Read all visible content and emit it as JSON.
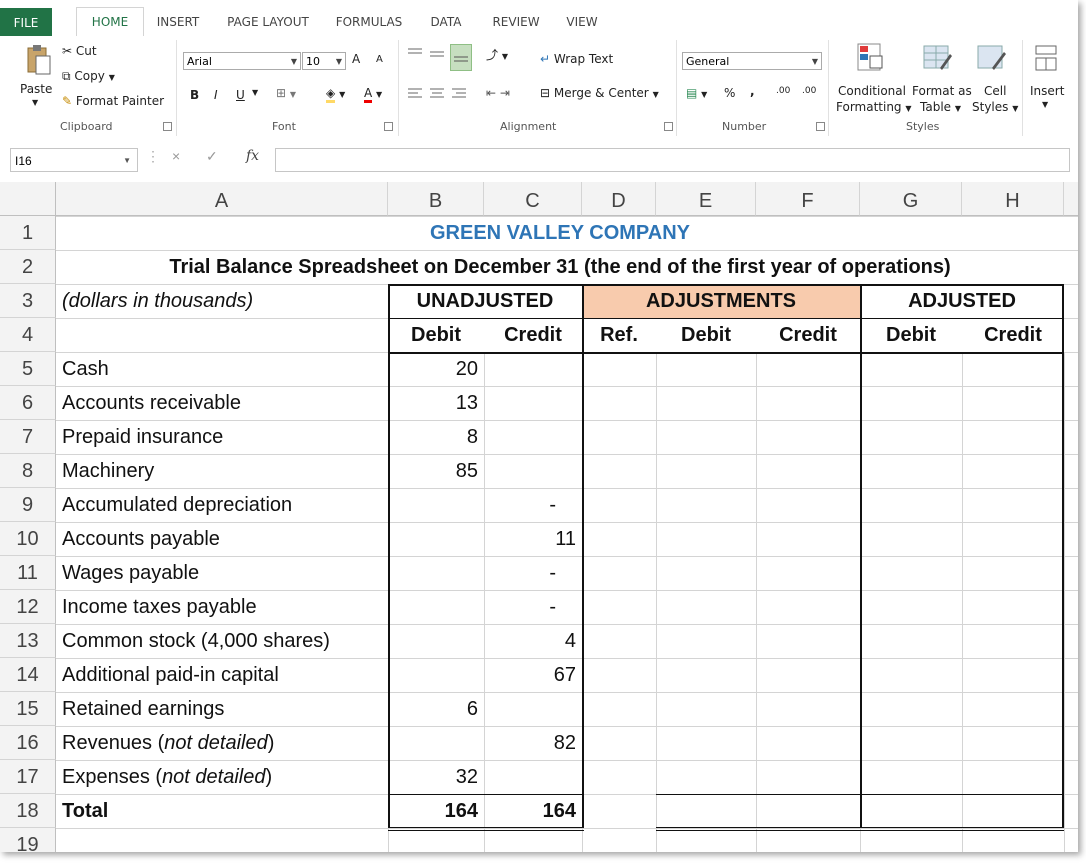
{
  "tabs": [
    "FILE",
    "HOME",
    "INSERT",
    "PAGE LAYOUT",
    "FORMULAS",
    "DATA",
    "REVIEW",
    "VIEW"
  ],
  "clipboard": {
    "paste": "Paste",
    "cut": "Cut",
    "copy": "Copy",
    "format_painter": "Format Painter",
    "label": "Clipboard"
  },
  "font": {
    "name": "Arial",
    "size": "10",
    "bold": "B",
    "italic": "I",
    "underline": "U",
    "grow": "A",
    "shrink": "A",
    "font_color": "A",
    "label": "Font"
  },
  "alignment": {
    "wrap": "Wrap Text",
    "merge": "Merge & Center",
    "label": "Alignment"
  },
  "number": {
    "format": "General",
    "percent": "%",
    "comma": ",",
    "inc_dec": ".00",
    "label": "Number"
  },
  "styles": {
    "conditional_1": "Conditional",
    "conditional_2": "Formatting",
    "format_table_1": "Format as",
    "format_table_2": "Table",
    "cell_styles_1": "Cell",
    "cell_styles_2": "Styles",
    "label": "Styles"
  },
  "cells_group": {
    "insert": "Insert"
  },
  "formula_bar": {
    "name_box": "I16",
    "fx": "fx",
    "cancel": "×",
    "enter": "✓"
  },
  "columns": [
    "A",
    "B",
    "C",
    "D",
    "E",
    "F",
    "G",
    "H"
  ],
  "sheet": {
    "title": "GREEN VALLEY COMPANY",
    "subtitle": "Trial Balance Spreadsheet on December 31 (the end of the first year of operations)",
    "units": "(dollars in thousands)",
    "unadjusted": "UNADJUSTED",
    "adjustments": "ADJUSTMENTS",
    "adjusted": "ADJUSTED",
    "debit": "Debit",
    "credit": "Credit",
    "ref": "Ref.",
    "rows": [
      {
        "n": "5",
        "acct": "Cash",
        "debit": "20",
        "credit": ""
      },
      {
        "n": "6",
        "acct": "Accounts receivable",
        "debit": "13",
        "credit": ""
      },
      {
        "n": "7",
        "acct": "Prepaid insurance",
        "debit": "8",
        "credit": ""
      },
      {
        "n": "8",
        "acct": "Machinery",
        "debit": "85",
        "credit": ""
      },
      {
        "n": "9",
        "acct": "Accumulated depreciation",
        "debit": "",
        "credit": "-"
      },
      {
        "n": "10",
        "acct": "Accounts payable",
        "debit": "",
        "credit": "11"
      },
      {
        "n": "11",
        "acct": "Wages payable",
        "debit": "",
        "credit": "-"
      },
      {
        "n": "12",
        "acct": "Income taxes payable",
        "debit": "",
        "credit": "-"
      },
      {
        "n": "13",
        "acct": "Common stock (4,000 shares)",
        "debit": "",
        "credit": "4"
      },
      {
        "n": "14",
        "acct": "Additional paid-in capital",
        "debit": "",
        "credit": "67"
      },
      {
        "n": "15",
        "acct": "Retained earnings",
        "debit": "6",
        "credit": ""
      },
      {
        "n": "16",
        "acct": "Revenues",
        "acct_note": "not detailed",
        "acct_close": ")",
        "debit": "",
        "credit": "82"
      },
      {
        "n": "17",
        "acct": "Expenses",
        "acct_note": "not detailed",
        "acct_close": ")",
        "debit": "32",
        "credit": ""
      }
    ],
    "total_label": "Total",
    "total_debit": "164",
    "total_credit": "164"
  },
  "colors": {
    "title": "#2e75b6",
    "adjust_fill": "#f8cbad",
    "excel_green": "#217346"
  }
}
